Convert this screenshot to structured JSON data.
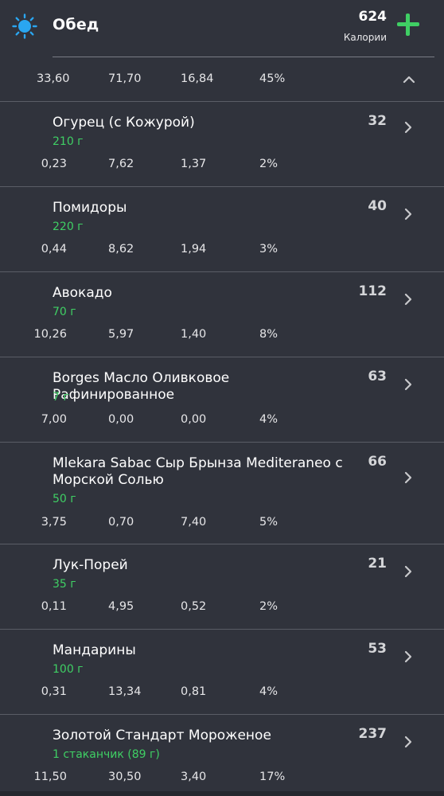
{
  "meal": {
    "title": "Обед",
    "calories": "624",
    "calories_label": "Калории",
    "icon": "sun-icon",
    "accent_color": "#3fcf64",
    "sun_color": "#2aa6f0"
  },
  "summary": {
    "fat": "33,60",
    "carbs": "71,70",
    "protein": "16,84",
    "percent": "45%"
  },
  "items": [
    {
      "name": "Огурец (с Кожурой)",
      "portion": "210 г",
      "calories": "32",
      "fat": "0,23",
      "carbs": "7,62",
      "protein": "1,37",
      "percent": "2%"
    },
    {
      "name": "Помидоры",
      "portion": "220 г",
      "calories": "40",
      "fat": "0,44",
      "carbs": "8,62",
      "protein": "1,94",
      "percent": "3%"
    },
    {
      "name": "Авокадо",
      "portion": "70 г",
      "calories": "112",
      "fat": "10,26",
      "carbs": "5,97",
      "protein": "1,40",
      "percent": "8%"
    },
    {
      "name": "Borges Масло Оливковое Рафинированное",
      "portion": "7 г",
      "calories": "63",
      "fat": "7,00",
      "carbs": "0,00",
      "protein": "0,00",
      "percent": "4%"
    },
    {
      "name": "Mlekara Sabac Сыр Брынза Mediteraneo с Морской Солью",
      "portion": "50 г",
      "calories": "66",
      "fat": "3,75",
      "carbs": "0,70",
      "protein": "7,40",
      "percent": "5%"
    },
    {
      "name": "Лук-Порей",
      "portion": "35 г",
      "calories": "21",
      "fat": "0,11",
      "carbs": "4,95",
      "protein": "0,52",
      "percent": "2%"
    },
    {
      "name": "Мандарины",
      "portion": "100 г",
      "calories": "53",
      "fat": "0,31",
      "carbs": "13,34",
      "protein": "0,81",
      "percent": "4%"
    },
    {
      "name": "Золотой Стандарт Мороженое",
      "portion": "1 стаканчик (89 г)",
      "calories": "237",
      "fat": "11,50",
      "carbs": "30,50",
      "protein": "3,40",
      "percent": "17%"
    }
  ]
}
